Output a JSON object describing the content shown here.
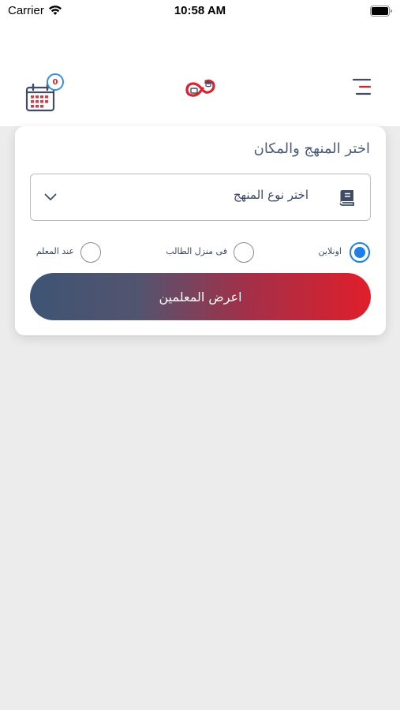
{
  "status_bar": {
    "carrier": "Carrier",
    "time": "10:58 AM"
  },
  "header": {
    "calendar_icon": "calendar-icon",
    "notification_count": "0",
    "logo_icon": "app-logo",
    "menu_icon": "menu-icon"
  },
  "search_card": {
    "title": "اختر المنهج والمكان",
    "curriculum_select": {
      "label": "اختر نوع المنهج",
      "icon": "book-icon"
    },
    "location_options": [
      {
        "label": "اونلاين",
        "selected": true
      },
      {
        "label": "فى منزل الطالب",
        "selected": false
      },
      {
        "label": "عند المعلم",
        "selected": false
      }
    ],
    "submit_label": "اعرض المعلمين"
  },
  "colors": {
    "accent_blue": "#1e7fe8",
    "brand_red": "#e11e2b",
    "brand_navy": "#3e5474",
    "background": "#ececec"
  }
}
